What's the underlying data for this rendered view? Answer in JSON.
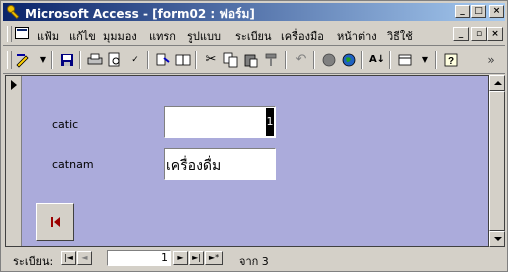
{
  "window": {
    "title": "Microsoft Access - [form02 : ฟอร์ม]",
    "min_label": "_",
    "max_label": "□",
    "close_label": "×"
  },
  "menubar": {
    "items": [
      "แฟ้ม",
      "แก้ไข",
      "มุมมอง",
      "แทรก",
      "รูปแบบ",
      "ระเบียน",
      "เครื่องมือ",
      "หน้าต่าง",
      "วิธีใช้"
    ],
    "min_label": "_",
    "max_label": "▫",
    "close_label": "×"
  },
  "toolbar": {
    "icons": [
      "design-view-icon",
      "save-icon",
      "print-icon",
      "print-preview-icon",
      "spelling-icon",
      "cut-icon",
      "copy-icon",
      "paste-icon",
      "format-painter-icon",
      "undo-icon",
      "insert-hyperlink-icon",
      "web-toolbar-icon",
      "sort-ascending-icon",
      "new-object-icon",
      "help-icon"
    ],
    "more_label": "»"
  },
  "form": {
    "background": "#ababdb",
    "fields": [
      {
        "label": "catic",
        "value": "1"
      },
      {
        "label": "catnam",
        "value": "เครื่องดื่ม"
      }
    ],
    "button_icon": "first-record-icon"
  },
  "navigation": {
    "label": "ระเบียน:",
    "current_record": "1",
    "of_label": "จาก",
    "total_records": "3",
    "first_label": "|◄",
    "prev_label": "◄",
    "next_label": "►",
    "last_label": "►|",
    "new_label": "►*"
  }
}
